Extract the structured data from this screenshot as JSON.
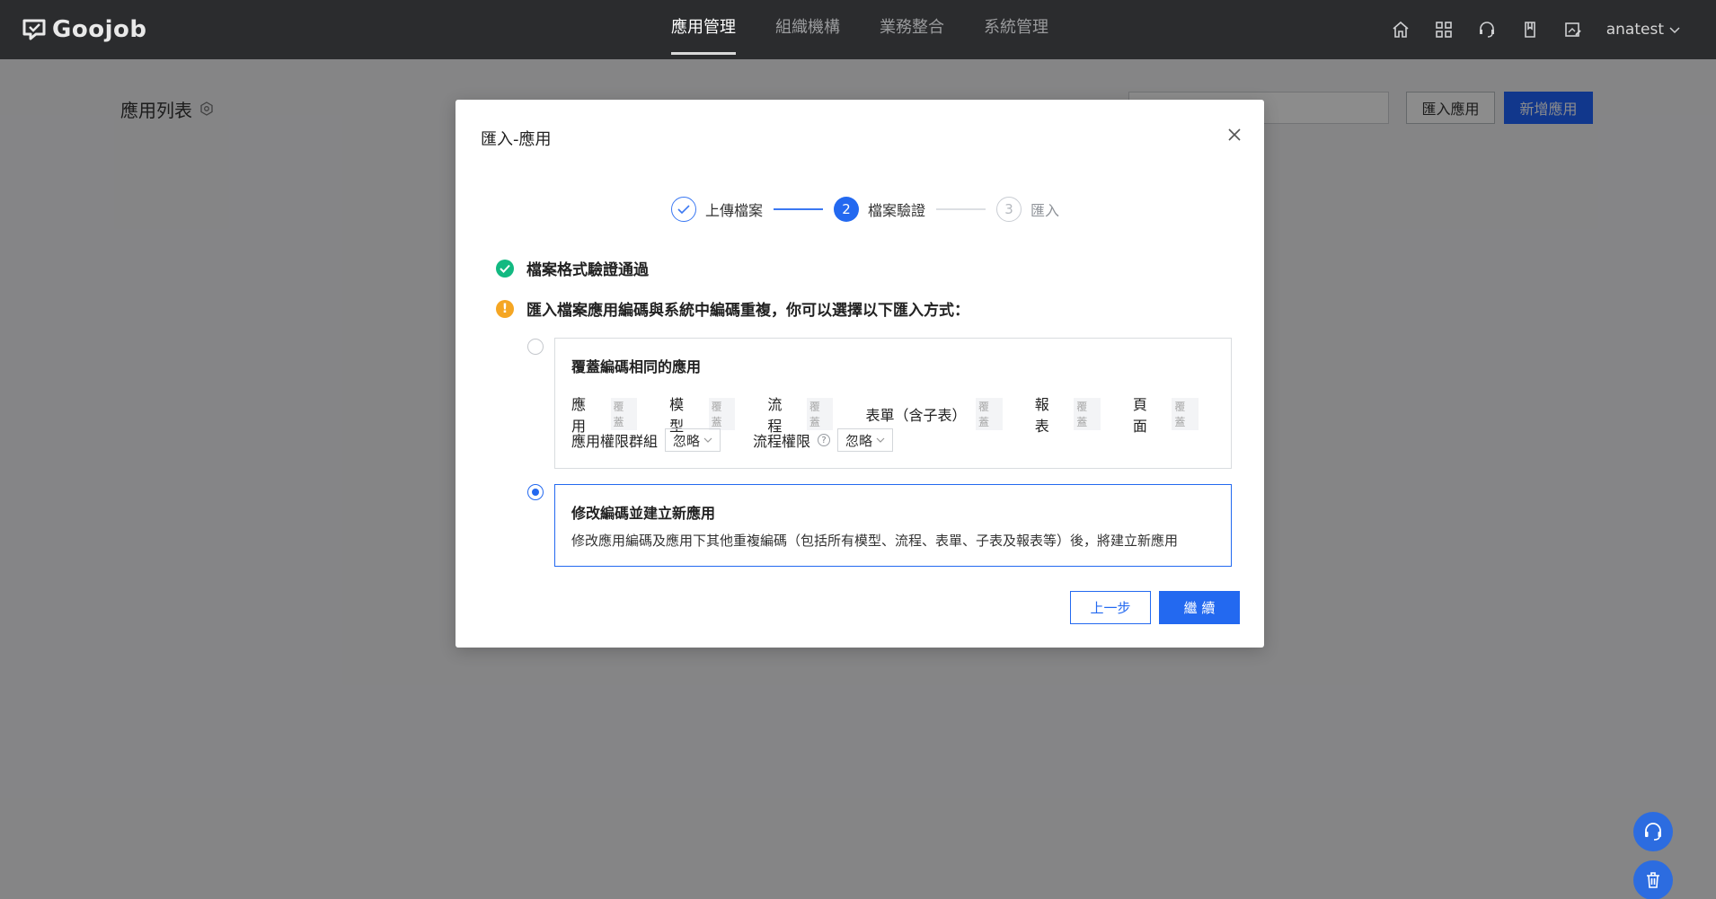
{
  "app": {
    "logo_text": "Goojob",
    "nav": [
      "應用管理",
      "組織機構",
      "業務整合",
      "系統管理"
    ],
    "active_nav_index": 0,
    "username": "anatest",
    "icons": [
      "home-icon",
      "apps-grid-icon",
      "headset-icon",
      "book-icon",
      "image-edit-icon"
    ]
  },
  "page": {
    "title": "應用列表",
    "search_placeholder": "",
    "import_button": "匯入應用",
    "new_button": "新增應用"
  },
  "modal": {
    "title": "匯入-應用",
    "steps": [
      {
        "label": "上傳檔案",
        "state": "done"
      },
      {
        "number": "2",
        "label": "檔案驗證",
        "state": "current"
      },
      {
        "number": "3",
        "label": "匯入",
        "state": "pending"
      }
    ],
    "message_ok": "檔案格式驗證通過",
    "message_warn": "匯入檔案應用編碼與系統中編碼重複，你可以選擇以下匯入方式：",
    "option1": {
      "title": "覆蓋編碼相同的應用",
      "items": [
        {
          "label": "應用",
          "tag": "覆蓋"
        },
        {
          "label": "模型",
          "tag": "覆蓋"
        },
        {
          "label": "流程",
          "tag": "覆蓋"
        },
        {
          "label": "表單（含子表）",
          "tag": "覆蓋"
        },
        {
          "label": "報表",
          "tag": "覆蓋"
        },
        {
          "label": "頁面",
          "tag": "覆蓋"
        }
      ],
      "perm_group_label": "應用權限群組",
      "perm_group_value": "忽略",
      "flow_perm_label": "流程權限",
      "flow_perm_value": "忽略",
      "selected": false
    },
    "option2": {
      "title": "修改編碼並建立新應用",
      "description": "修改應用編碼及應用下其他重複編碼（包括所有模型、流程、表單、子表及報表等）後，將建立新應用",
      "selected": true
    },
    "prev_button": "上一步",
    "next_button": "繼 續"
  },
  "colors": {
    "primary": "#2369f0",
    "topbar": "#2b2c2e",
    "success": "#12b981",
    "warning": "#f5a623"
  }
}
